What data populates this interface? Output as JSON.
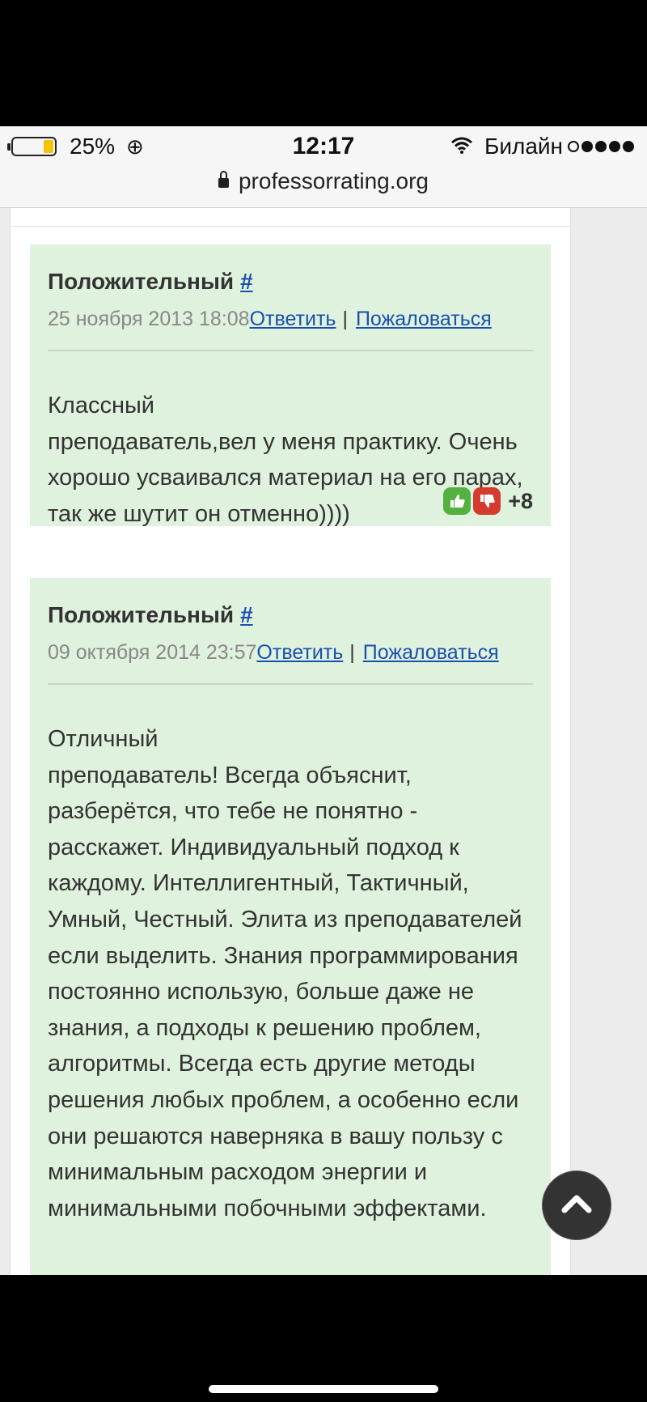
{
  "status_bar": {
    "battery_percent": "25%",
    "time": "12:17",
    "carrier": "Билайн"
  },
  "browser": {
    "url": "professorrating.org"
  },
  "reviews": [
    {
      "type": "Положительный",
      "anchor": "#",
      "date": "25 ноября 2013 18:08",
      "reply_label": "Ответить",
      "separator": "|",
      "report_label": "Пожаловаться",
      "text": "Классный\nпреподаватель,вел у меня практику. Очень хорошо усваивался материал на его парах, так же шутит он отменно))))",
      "score": "+8"
    },
    {
      "type": "Положительный",
      "anchor": "#",
      "date": "09 октября 2014 23:57",
      "reply_label": "Ответить",
      "separator": "|",
      "report_label": "Пожаловаться",
      "text": "Отличный\nпреподаватель! Всегда объяснит, разберётся, что тебе не понятно - расскажет. Индивидуальный подход к каждому. Интеллигентный, Тактичный, Умный, Честный. Элита из преподавателей если выделить. Знания программирования постоянно использую, больше даже не знания, а подходы к решению проблем, алгоритмы. Всегда есть другие методы решения любых проблем, а особенно если они решаются наверняка в вашу пользу с минимальным расходом энергии и минимальными побочными эффектами."
    }
  ],
  "colors": {
    "review_bg": "#dff2dd",
    "link": "#1a4fb0",
    "vote_up": "#55b13f",
    "vote_down": "#d53a2e"
  },
  "icons": {
    "vote_up": "thumbs-up-icon",
    "vote_down": "thumbs-down-icon",
    "scroll_top": "chevron-up-icon"
  }
}
